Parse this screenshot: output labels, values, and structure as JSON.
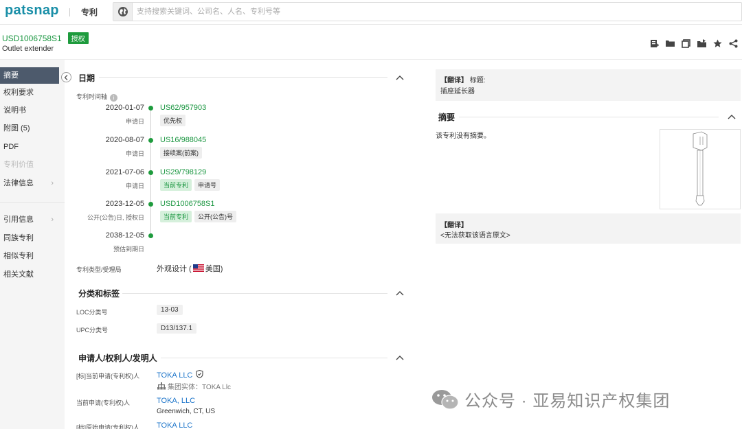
{
  "brand": {
    "logo": "patsnap",
    "product": "专利"
  },
  "search": {
    "placeholder": "支持搜索关键词、公司名、人名、专利号等"
  },
  "header": {
    "patent_number": "USD1006758S1",
    "status_badge": "授权",
    "title_en": "Outlet extender",
    "toolbar_icons": [
      "add-to-folder-icon",
      "folder-icon",
      "copy-icon",
      "export-icon",
      "star-icon",
      "share-icon"
    ]
  },
  "sidebar": {
    "items": [
      {
        "label": "摘要",
        "active": true
      },
      {
        "label": "权利要求"
      },
      {
        "label": "说明书"
      },
      {
        "label": "附图 (5)"
      },
      {
        "label": "PDF"
      },
      {
        "label": "专利价值",
        "disabled": true
      },
      {
        "label": "法律信息",
        "has_chevron": true
      },
      {
        "label": "引用信息",
        "has_chevron": true
      },
      {
        "label": "同族专利"
      },
      {
        "label": "相似专利"
      },
      {
        "label": "相关文献"
      }
    ]
  },
  "dates": {
    "title": "日期",
    "timeline_label": "专利时间轴",
    "events": [
      {
        "date": "2020-01-07",
        "type": "申请日",
        "number": "US62/957903",
        "tags": [
          {
            "text": "优先权",
            "green": false
          }
        ]
      },
      {
        "date": "2020-08-07",
        "type": "申请日",
        "number": "US16/988045",
        "tags": [
          {
            "text": "接续案(前案)",
            "green": false
          }
        ]
      },
      {
        "date": "2021-07-06",
        "type": "申请日",
        "number": "US29/798129",
        "tags": [
          {
            "text": "当前专利",
            "green": true
          },
          {
            "text": "申请号",
            "green": false
          }
        ]
      },
      {
        "date": "2023-12-05",
        "type": "公开(公告)日, 授权日",
        "number": "USD1006758S1",
        "tags": [
          {
            "text": "当前专利",
            "green": true
          },
          {
            "text": "公开(公告)号",
            "green": false
          }
        ]
      },
      {
        "date": "2038-12-05",
        "type": "预估到期日",
        "number": "",
        "tags": []
      }
    ],
    "patent_type_label": "专利类型/受理局",
    "patent_type_value": "外观设计 (",
    "country": "美国)"
  },
  "classification": {
    "title": "分类和标签",
    "loc_label": "LOC分类号",
    "loc_value": "13-03",
    "upc_label": "UPC分类号",
    "upc_value": "D13/137.1"
  },
  "applicants": {
    "title": "申请人/权利人/发明人",
    "current_applicant_std_label": "[标]当前申请(专利权)人",
    "current_applicant_std": "TOKA LLC",
    "group_entity_label": "集团实体：",
    "group_entity": "TOKA Llc",
    "current_applicant_label": "当前申请(专利权)人",
    "current_applicant": "TOKA, LLC",
    "current_applicant_address": "Greenwich, CT, US",
    "original_applicant_std_label": "[标]原始申请(专利权)人",
    "original_applicant_std": "TOKA LLC"
  },
  "right_panel": {
    "translate_tag": "【翻译】",
    "title_label": "标题:",
    "title_cn": "插座延长器",
    "abstract_title": "摘要",
    "abstract_text": "该专利没有摘要。",
    "translate_tag2": "【翻译】",
    "no_original": "<无法获取该语言原文>"
  },
  "watermark": {
    "text": "公众号 · 亚易知识产权集团"
  },
  "colors": {
    "brand": "#1a8fa8",
    "green": "#1e9b3d",
    "link": "#1a73c9",
    "sidebar_active": "#4d5a6c"
  }
}
